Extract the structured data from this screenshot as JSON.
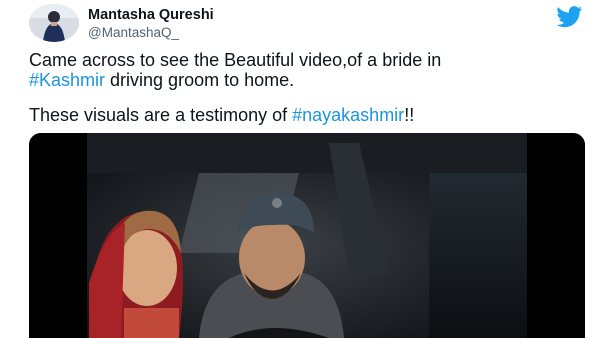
{
  "tweet": {
    "display_name": "Mantasha Qureshi",
    "handle": "@MantashaQ_",
    "line1": "Came across to see the Beautiful video,of a bride in",
    "line2_hashtag": "#Kashmir",
    "line2_rest": " driving groom to home.",
    "line3_text": "These visuals are a testimony of ",
    "line3_hashtag": "#nayakashmir",
    "line3_end": "!!"
  },
  "icons": {
    "brand": "twitter-bird-icon",
    "avatar": "avatar-photo"
  },
  "colors": {
    "hashtag": "#1b95e0",
    "twitter_blue": "#1da1f2",
    "text": "#0f1419",
    "secondary": "#536471"
  }
}
